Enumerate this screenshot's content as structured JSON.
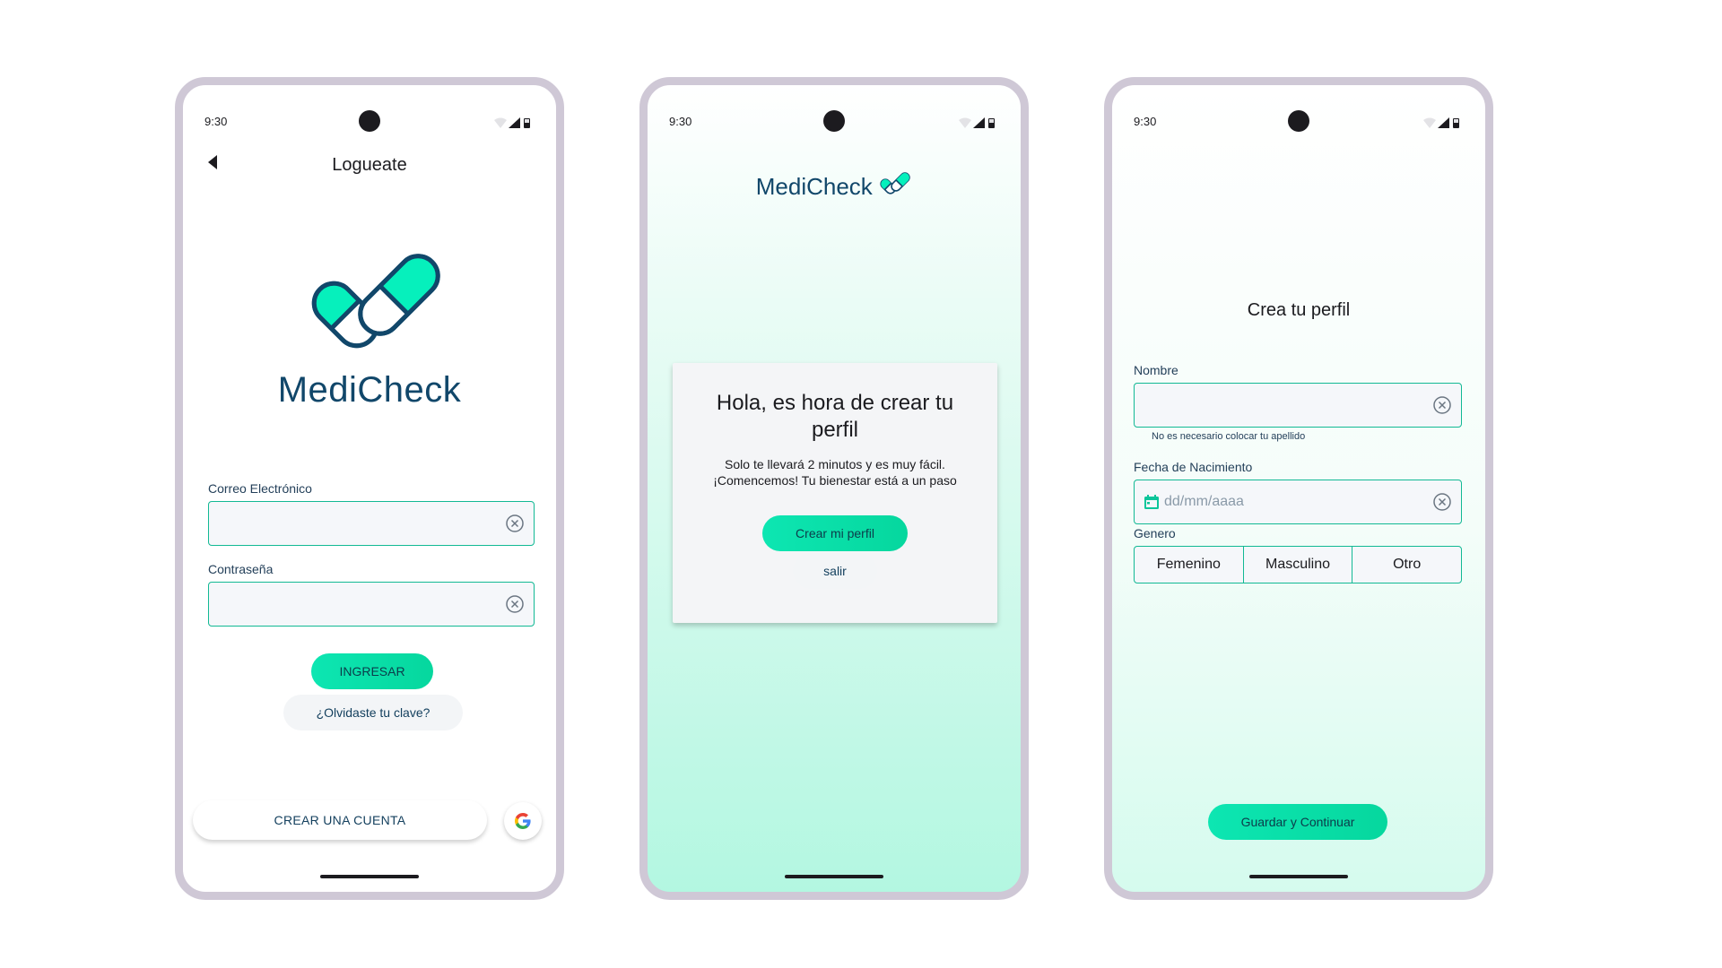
{
  "status_bar": {
    "time": "9:30"
  },
  "login": {
    "title": "Logueate",
    "brand": "MediCheck",
    "email_label": "Correo Electrónico",
    "email_value": "",
    "password_label": "Contraseña",
    "password_value": "",
    "submit_label": "INGRESAR",
    "forgot_label": "¿Olvidaste tu clave?",
    "create_account_label": "CREAR UNA CUENTA"
  },
  "welcome": {
    "brand": "MediCheck",
    "heading": "Hola, es hora de crear tu perfil",
    "body": "Solo te llevará 2 minutos y es muy fácil. ¡Comencemos! Tu bienestar está a un paso",
    "primary_label": "Crear mi perfil",
    "secondary_label": "salir"
  },
  "profile": {
    "title": "Crea tu perfil",
    "name_label": "Nombre",
    "name_value": "",
    "name_helper": "No es necesario colocar tu apellido",
    "birth_label": "Fecha de Nacimiento",
    "birth_placeholder": "dd/mm/aaaa",
    "gender_label": "Genero",
    "gender_options": [
      "Femenino",
      "Masculino",
      "Otro"
    ],
    "save_label": "Guardar y Continuar"
  },
  "icons": [
    "back-arrow-icon",
    "clear-icon",
    "google-icon",
    "calendar-icon",
    "wifi-icon",
    "signal-icon",
    "battery-icon"
  ],
  "colors": {
    "brand": "#11476a",
    "accent": "#06dba3",
    "outline": "#12b994"
  }
}
